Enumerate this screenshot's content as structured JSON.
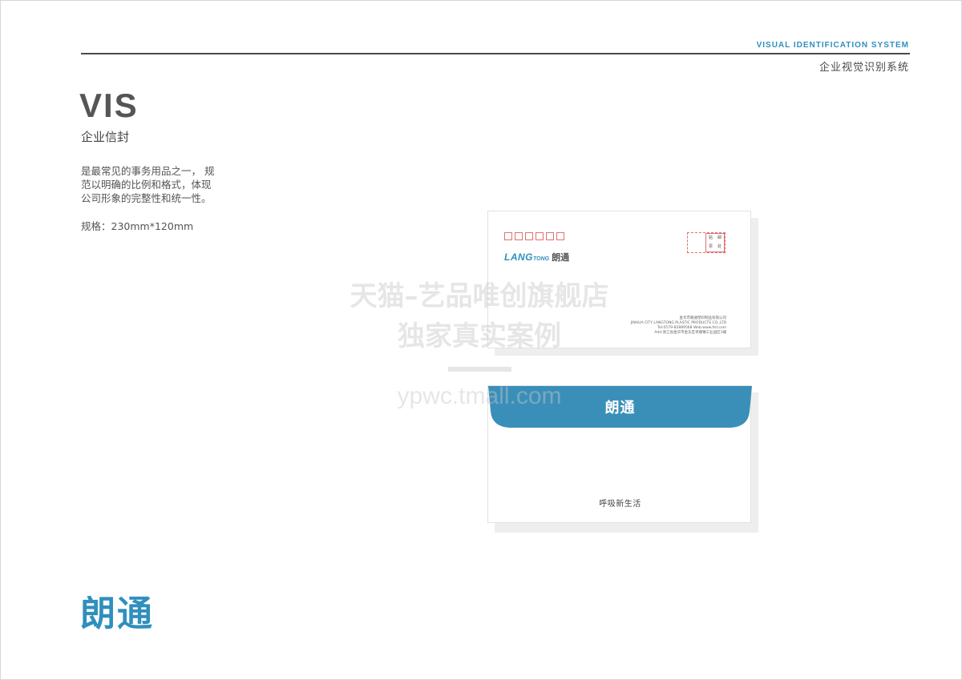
{
  "header": {
    "title_en": "VISUAL IDENTIFICATION SYSTEM",
    "title_cn": "企业视觉识别系统"
  },
  "section": {
    "code": "VIS",
    "title": "企业信封",
    "description_lines": [
      "是最常见的事务用品之一， 规",
      "范以明确的比例和格式，体现",
      "公司形象的完整性和统一性。"
    ],
    "spec": "规格：230mm*120mm"
  },
  "brand": {
    "logo_cn": "朗通",
    "logo_en_main": "LANG",
    "logo_en_small": "TONG",
    "color_primary": "#2f8fbd"
  },
  "envelope_front": {
    "postcode_boxes": 6,
    "stamp_label": [
      "贴",
      "邮",
      "票",
      "处"
    ],
    "address_lines": [
      "金华市朗通塑料制品有限公司",
      "JINHUA CITY LANGTONG PLASTIC PRODUCTS CO.,LTD",
      "Tel:0579-82889568  Web:www.ltsl.com",
      "Add:浙江省金华市金东区孝顺镇工业园区1幢"
    ]
  },
  "envelope_back": {
    "flap_text": "朗通",
    "slogan": "呼吸新生活",
    "flap_color": "#3a8fb9"
  },
  "watermark": {
    "line1": "天猫–艺品唯创旗舰店",
    "line2": "独家真实案例",
    "url": "ypwc.tmall.com"
  }
}
